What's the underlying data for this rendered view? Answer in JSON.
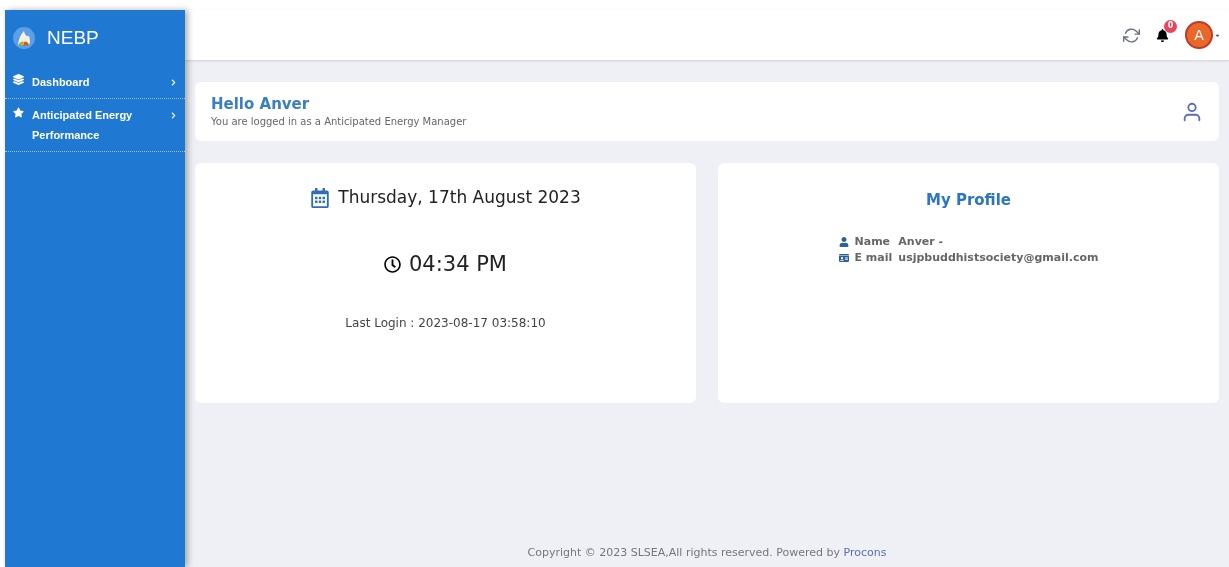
{
  "sidebar": {
    "brand": "NEBP",
    "items": [
      {
        "label": "Dashboard",
        "selected": false
      },
      {
        "label": "Anticipated Energy Performance",
        "selected": false
      }
    ]
  },
  "header": {
    "notifications": "0",
    "avatar": "A"
  },
  "greeting": {
    "title": "Hello Anver",
    "subtitle": "You are logged in as a Anticipated Energy Manager"
  },
  "clock": {
    "date": "Thursday, 17th August 2023",
    "time": "04:34 PM",
    "last_login": "Last Login : 2023-08-17 03:58:10"
  },
  "profile": {
    "title": "My Profile",
    "fields": [
      {
        "label": "Name",
        "value": "Anver -"
      },
      {
        "label": "E mail",
        "value": "usjpbuddhistsociety@gmail.com"
      }
    ]
  },
  "footer": {
    "text": "Copyright © 2023 SLSEA,All rights reserved. Powered by",
    "link": "Procons"
  }
}
